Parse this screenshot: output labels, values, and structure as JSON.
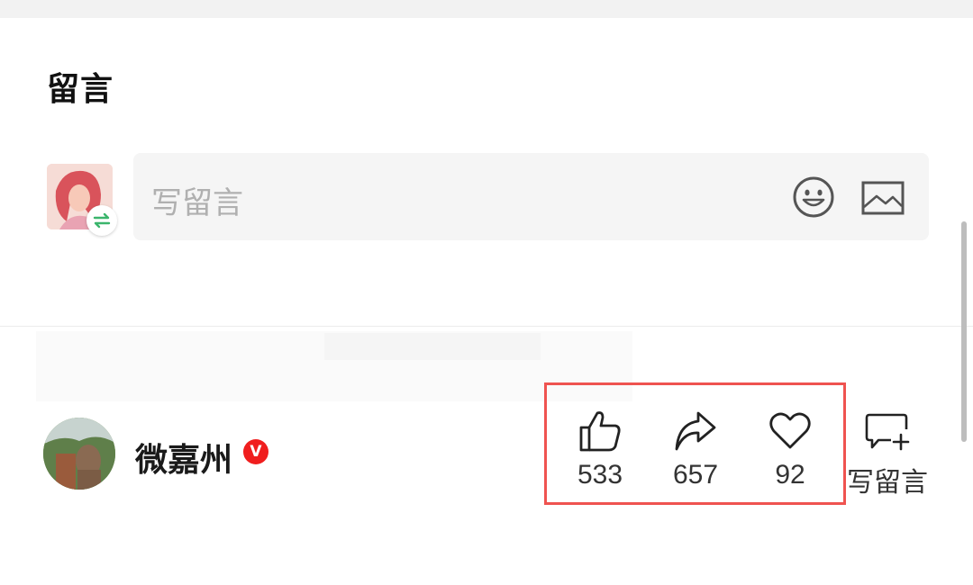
{
  "comments_section": {
    "title": "留言",
    "input": {
      "placeholder": "写留言"
    }
  },
  "account": {
    "name": "微嘉州",
    "verified_mark": "V"
  },
  "actions": {
    "like_count": "533",
    "share_count": "657",
    "favorite_count": "92",
    "write_comment_label": "写留言"
  },
  "colors": {
    "highlight_border": "#ef5350",
    "verified_red": "#f01e1e",
    "switch_green": "#3bb56c",
    "input_bg": "#f5f5f5"
  },
  "icons": {
    "emoji": "smiley-face-icon",
    "image": "image-icon",
    "like": "thumbs-up-icon",
    "share": "share-arrow-icon",
    "favorite": "heart-icon",
    "write": "comment-plus-icon",
    "switch": "swap-arrows-icon"
  }
}
